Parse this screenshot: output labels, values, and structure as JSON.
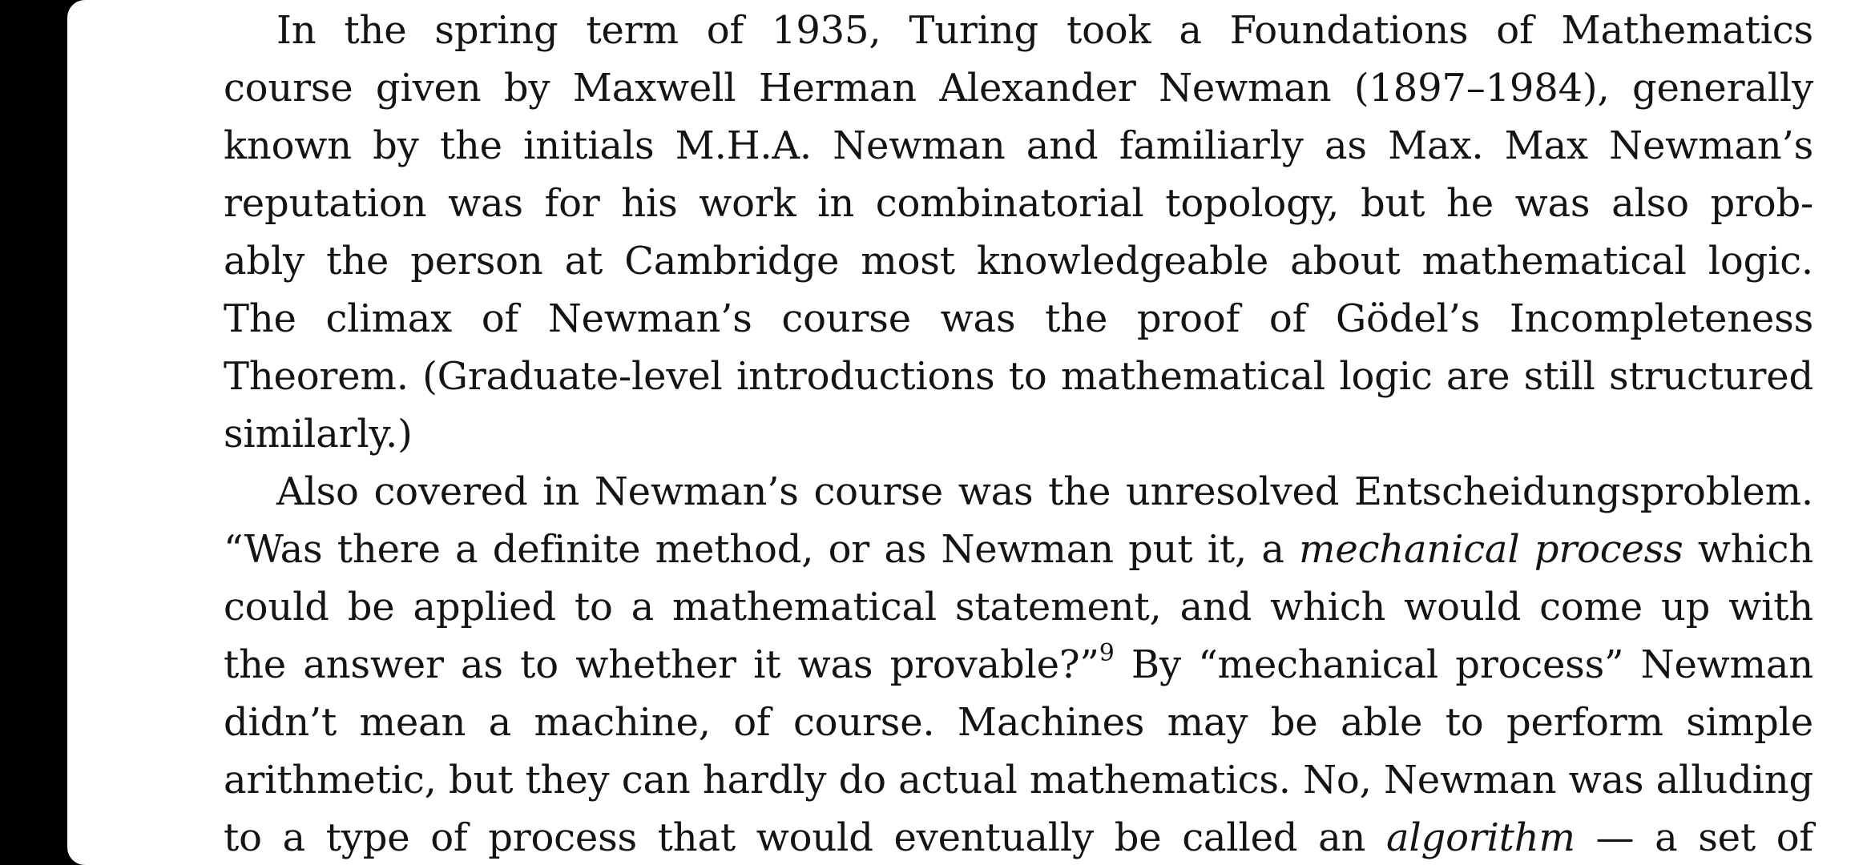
{
  "document": {
    "paragraphs": [
      {
        "lines": [
          {
            "text": "In the spring term of 1935, Turing took a Foundations of Mathematics"
          },
          {
            "text": "course given by Maxwell Herman Alexander Newman (1897–1984), generally"
          },
          {
            "text": "known by the initials M.H.A. Newman and familiarly as Max. Max Newman’s"
          },
          {
            "text": "reputation was for his work in combinatorial topology, but he was also prob-"
          },
          {
            "text": "ably the person at Cambridge most knowledgeable about mathematical logic."
          },
          {
            "text": "The climax of Newman’s course was the proof of Gödel’s Incompleteness"
          },
          {
            "text": "Theorem. (Graduate-level introductions to mathematical logic are still structured"
          },
          {
            "text": "similarly.)"
          }
        ]
      },
      {
        "line1": "Also covered in Newman’s course was the unresolved Entscheidungsproblem.",
        "line2_a": "“Was there a definite method, or as Newman put it, a ",
        "line2_em": "mechanical process",
        "line2_b": " which",
        "line3": "could be applied to a mathematical statement, and which would come up with",
        "line4_a": "the answer as to whether it was provable?”",
        "line4_footnote": "9",
        "line4_b": " By “mechanical process” Newman",
        "line5": "didn’t mean a machine, of course. Machines may be able to perform simple",
        "line6": "arithmetic, but they can hardly do actual mathematics. No, Newman was alluding",
        "line7_a": "to a type of process that would eventually be called an ",
        "line7_em": "algorithm",
        "line7_b": " — a set of"
      }
    ]
  }
}
